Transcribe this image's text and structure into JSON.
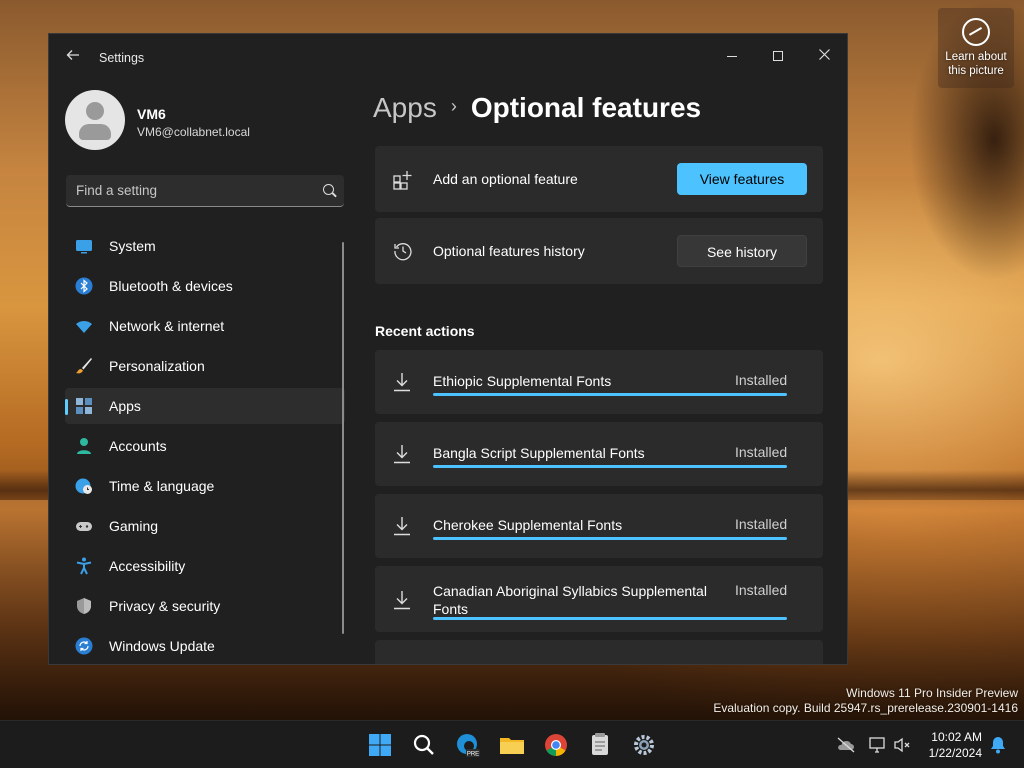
{
  "desktop": {
    "learn_line1": "Learn about",
    "learn_line2": "this picture",
    "watermark_line1": "Windows 11 Pro Insider Preview",
    "watermark_line2": "Evaluation copy. Build 25947.rs_prerelease.230901-1416"
  },
  "window": {
    "title": "Settings",
    "back_icon": "arrow-left-icon"
  },
  "profile": {
    "name": "VM6",
    "email": "VM6@collabnet.local"
  },
  "search": {
    "placeholder": "Find a setting"
  },
  "nav": {
    "items": [
      {
        "label": "System",
        "icon": "system-icon",
        "active": false
      },
      {
        "label": "Bluetooth & devices",
        "icon": "bluetooth-icon",
        "active": false
      },
      {
        "label": "Network & internet",
        "icon": "wifi-icon",
        "active": false
      },
      {
        "label": "Personalization",
        "icon": "brush-icon",
        "active": false
      },
      {
        "label": "Apps",
        "icon": "apps-icon",
        "active": true
      },
      {
        "label": "Accounts",
        "icon": "person-icon",
        "active": false
      },
      {
        "label": "Time & language",
        "icon": "globe-clock-icon",
        "active": false
      },
      {
        "label": "Gaming",
        "icon": "gamepad-icon",
        "active": false
      },
      {
        "label": "Accessibility",
        "icon": "accessibility-icon",
        "active": false
      },
      {
        "label": "Privacy & security",
        "icon": "shield-icon",
        "active": false
      },
      {
        "label": "Windows Update",
        "icon": "update-icon",
        "active": false
      }
    ]
  },
  "breadcrumb": {
    "parent": "Apps",
    "current": "Optional features"
  },
  "cards": {
    "add_label": "Add an optional feature",
    "add_button": "View features",
    "history_label": "Optional features history",
    "history_button": "See history"
  },
  "recent": {
    "heading": "Recent actions",
    "items": [
      {
        "name": "Ethiopic Supplemental Fonts",
        "status": "Installed",
        "progress": 1.0
      },
      {
        "name": "Bangla Script Supplemental Fonts",
        "status": "Installed",
        "progress": 1.0
      },
      {
        "name": "Cherokee Supplemental Fonts",
        "status": "Installed",
        "progress": 1.0
      },
      {
        "name": "Canadian Aboriginal Syllabics Supplemental Fonts",
        "status": "Installed",
        "progress": 1.0
      }
    ]
  },
  "taskbar": {
    "time": "10:02 AM",
    "date": "1/22/2024"
  },
  "colors": {
    "accent": "#4cc2ff",
    "window_bg": "#202020",
    "card_bg": "#2b2b2b"
  }
}
